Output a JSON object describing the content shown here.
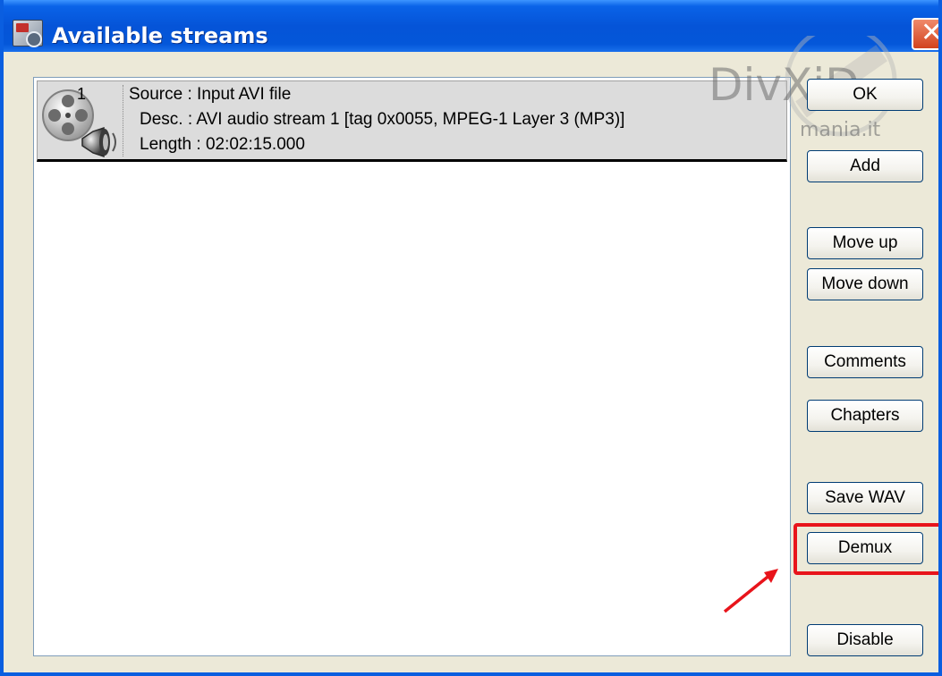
{
  "window": {
    "title": "Available streams",
    "close_glyph": "✕"
  },
  "streams": [
    {
      "number": "1",
      "icon": "audio-stream-icon",
      "source": "Source : Input AVI file",
      "desc": "Desc. : AVI audio stream 1 [tag 0x0055, MPEG-1 Layer 3 (MP3)]",
      "length": "Length : 02:02:15.000"
    }
  ],
  "buttons": {
    "ok": "OK",
    "add": "Add",
    "move_up": "Move up",
    "move_down": "Move down",
    "comments": "Comments",
    "chapters": "Chapters",
    "save_wav": "Save WAV",
    "demux": "Demux",
    "disable": "Disable"
  },
  "watermark": {
    "brand": "DivXiD",
    "site": "mania.it"
  },
  "colors": {
    "titlebar": "#0554d8",
    "highlight": "#e8141b",
    "dialog_bg": "#ece9d8"
  }
}
